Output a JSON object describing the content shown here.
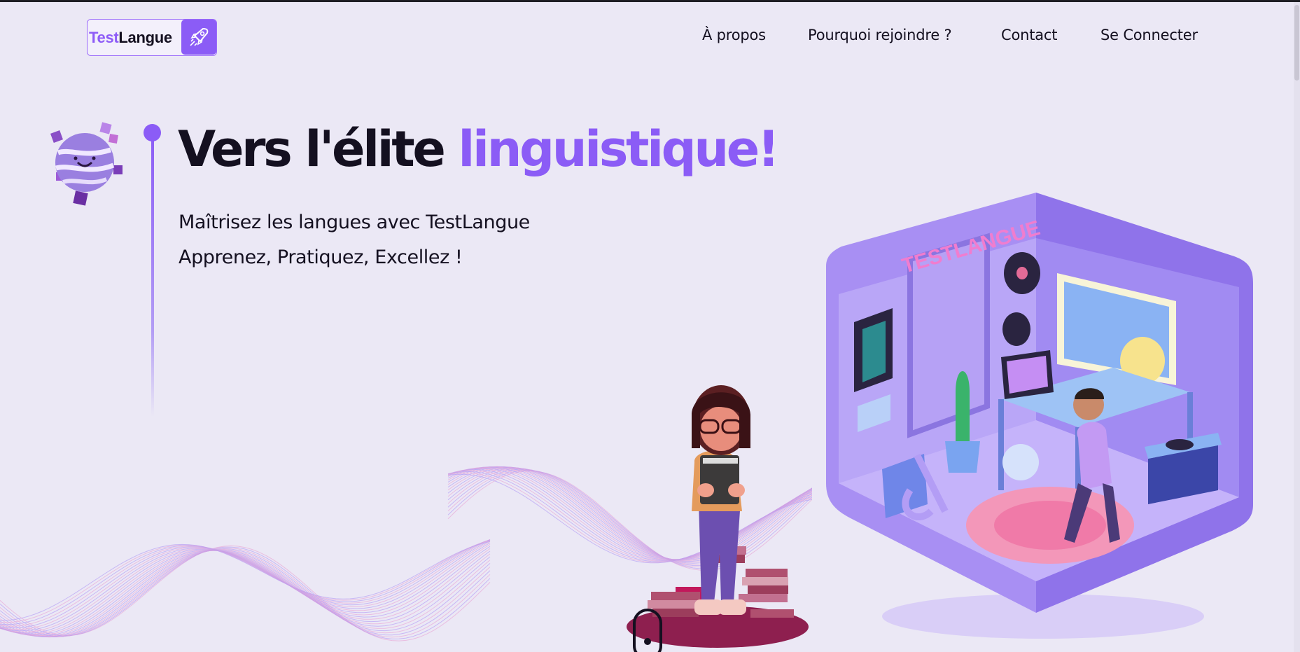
{
  "header": {
    "logo": {
      "part1": "Test",
      "part2": "Langue",
      "icon": "rocket-icon"
    },
    "nav": [
      {
        "label": "À propos"
      },
      {
        "label": "Pourquoi rejoindre ?"
      },
      {
        "label": "Contact"
      },
      {
        "label": "Se Connecter"
      }
    ]
  },
  "hero": {
    "title_part1": "Vers l'élite ",
    "title_part2": "linguistique!",
    "subtitle_line1": "Maîtrisez les langues avec TestLangue",
    "subtitle_line2": "Apprenez, Pratiquez, Excellez !"
  },
  "room": {
    "sign": "TESTLANGUE"
  },
  "colors": {
    "accent": "#8b5cf6",
    "background": "#ebe8f5",
    "text": "#141020"
  },
  "icons": [
    "rocket-icon",
    "planet-mascot-icon",
    "mouse-scroll-icon"
  ]
}
